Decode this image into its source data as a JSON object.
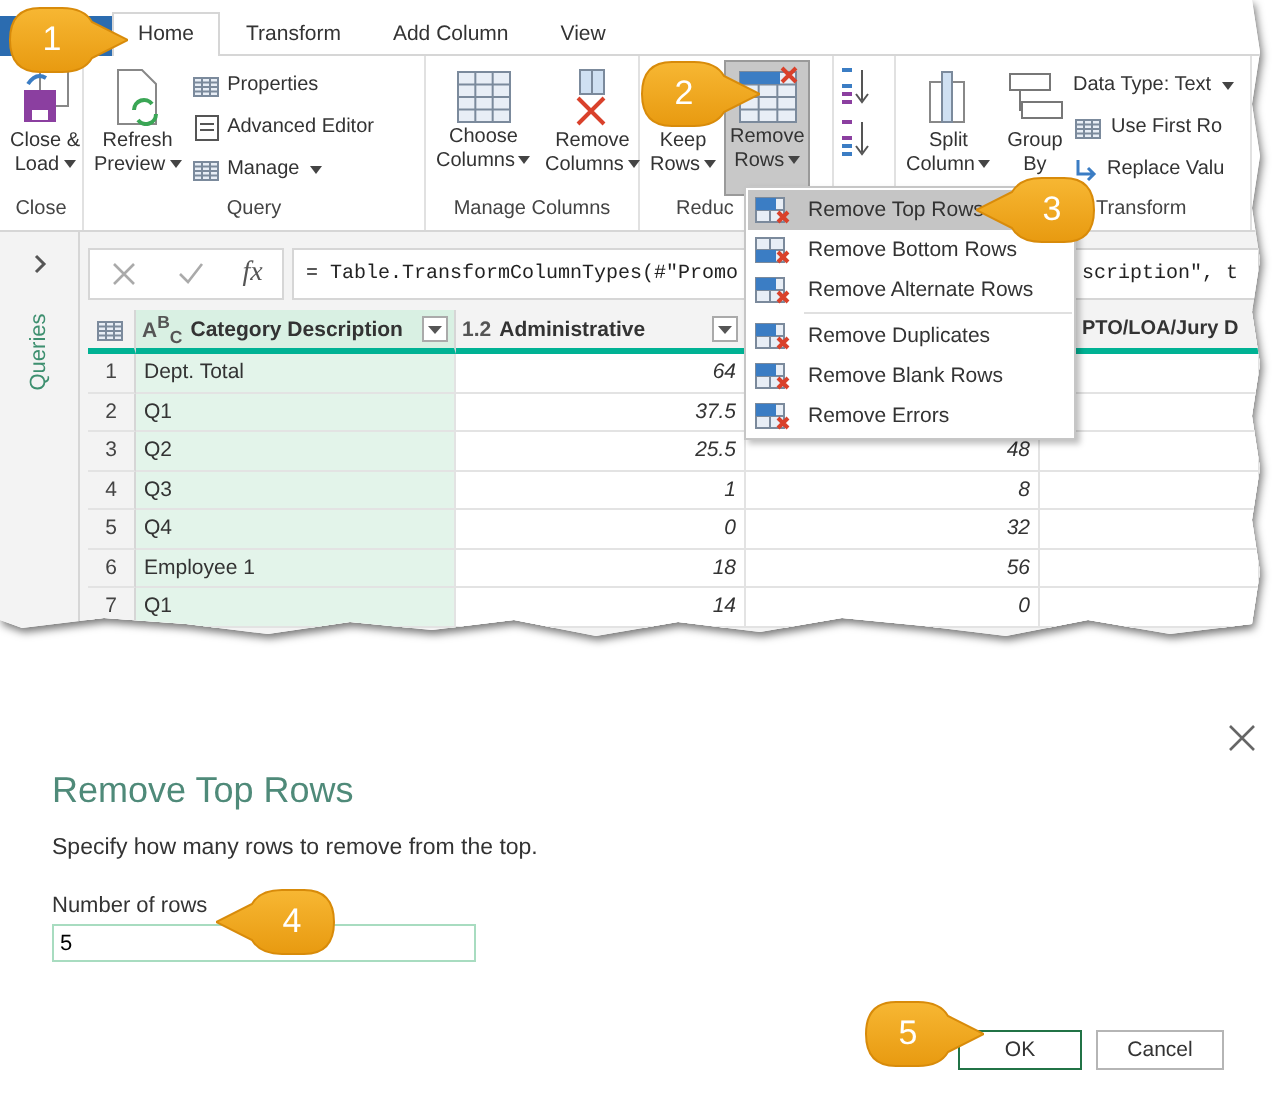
{
  "ribbon": {
    "tabs": [
      {
        "label": "Home",
        "selected": true
      },
      {
        "label": "Transform",
        "selected": false
      },
      {
        "label": "Add Column",
        "selected": false
      },
      {
        "label": "View",
        "selected": false
      }
    ],
    "groups": [
      {
        "label": "Close",
        "items": [
          {
            "kind": "large",
            "lines": [
              "Close &",
              "Load"
            ],
            "dropdown": true,
            "highlighted": false
          }
        ]
      },
      {
        "label": "Query",
        "items": [
          {
            "kind": "large",
            "lines": [
              "Refresh",
              "Preview"
            ],
            "dropdown": true,
            "highlighted": false
          },
          {
            "kind": "stack",
            "items": [
              {
                "label": "Properties",
                "dropdown": false
              },
              {
                "label": "Advanced Editor",
                "dropdown": false
              },
              {
                "label": "Manage",
                "dropdown": true
              }
            ]
          }
        ]
      },
      {
        "label": "Manage Columns",
        "items": [
          {
            "kind": "large",
            "lines": [
              "Choose",
              "Columns"
            ],
            "dropdown": true,
            "highlighted": false
          },
          {
            "kind": "large",
            "lines": [
              "Remove",
              "Columns"
            ],
            "dropdown": true,
            "highlighted": false
          }
        ]
      },
      {
        "label": "Reduc",
        "items": [
          {
            "kind": "large",
            "lines": [
              "Keep",
              "Rows"
            ],
            "dropdown": true,
            "highlighted": false
          },
          {
            "kind": "large",
            "lines": [
              "Remove",
              "Rows"
            ],
            "dropdown": true,
            "highlighted": true
          }
        ]
      },
      {
        "items": [
          {
            "kind": "sort_pair"
          }
        ]
      },
      {
        "label": "Transform",
        "items": [
          {
            "kind": "large",
            "lines": [
              "Split",
              "Column"
            ],
            "dropdown": true,
            "highlighted": false
          },
          {
            "kind": "large",
            "lines": [
              "Group",
              "By"
            ],
            "dropdown": false,
            "highlighted": false
          },
          {
            "kind": "stack",
            "items": [
              {
                "label": "Data Type: Text",
                "dropdown": true
              },
              {
                "label": "Use First Ro",
                "dropdown": false
              },
              {
                "label": "Replace Valu",
                "dropdown": false
              }
            ]
          }
        ]
      }
    ]
  },
  "sidebar": {
    "label": "Queries"
  },
  "formula_bar": {
    "function_label": "fx",
    "formula_start": "= Table.TransformColumnTypes(#\"Promo",
    "formula_end": "scription\", t"
  },
  "table": {
    "columns": [
      {
        "type_label": "A$^{B}$$_{C}$",
        "name": "Category Description",
        "kind": "text",
        "selected": true,
        "filter": true
      },
      {
        "type_label": "1.2",
        "name": "Administrative",
        "kind": "number",
        "selected": false,
        "filter": true
      },
      {
        "kind": "number",
        "selected": false
      },
      {
        "name": "PTO/LOA/Jury D",
        "kind": "number",
        "selected": false
      }
    ],
    "rows": [
      {
        "number": "1",
        "cells": [
          "Dept. Total",
          "64",
          null,
          null
        ]
      },
      {
        "number": "2",
        "cells": [
          "Q1",
          "37.5",
          null,
          null
        ]
      },
      {
        "number": "3",
        "cells": [
          "Q2",
          "25.5",
          "48",
          null
        ]
      },
      {
        "number": "4",
        "cells": [
          "Q3",
          "1",
          "8",
          null
        ]
      },
      {
        "number": "5",
        "cells": [
          "Q4",
          "0",
          "32",
          null
        ]
      },
      {
        "number": "6",
        "cells": [
          "Employee 1",
          "18",
          "56",
          null
        ]
      },
      {
        "number": "7",
        "cells": [
          "Q1",
          "14",
          "0",
          null
        ]
      }
    ]
  },
  "menu": {
    "sections": [
      {
        "items": [
          {
            "label": "Remove Top Rows",
            "selected": true
          },
          {
            "label": "Remove Bottom Rows",
            "selected": false
          },
          {
            "label": "Remove Alternate Rows",
            "selected": false
          }
        ]
      },
      {
        "items": [
          {
            "label": "Remove Duplicates",
            "selected": false
          },
          {
            "label": "Remove Blank Rows",
            "selected": false
          },
          {
            "label": "Remove Errors",
            "selected": false
          }
        ]
      }
    ]
  },
  "dialog": {
    "title": "Remove Top Rows",
    "description": "Specify how many rows to remove from the top.",
    "field": {
      "label": "Number of rows",
      "value": "5"
    },
    "buttons": [
      {
        "label": "OK",
        "primary": true
      },
      {
        "label": "Cancel",
        "primary": false
      }
    ]
  },
  "callouts": [
    {
      "number": "1"
    },
    {
      "number": "2"
    },
    {
      "number": "3"
    },
    {
      "number": "4"
    },
    {
      "number": "5"
    }
  ]
}
